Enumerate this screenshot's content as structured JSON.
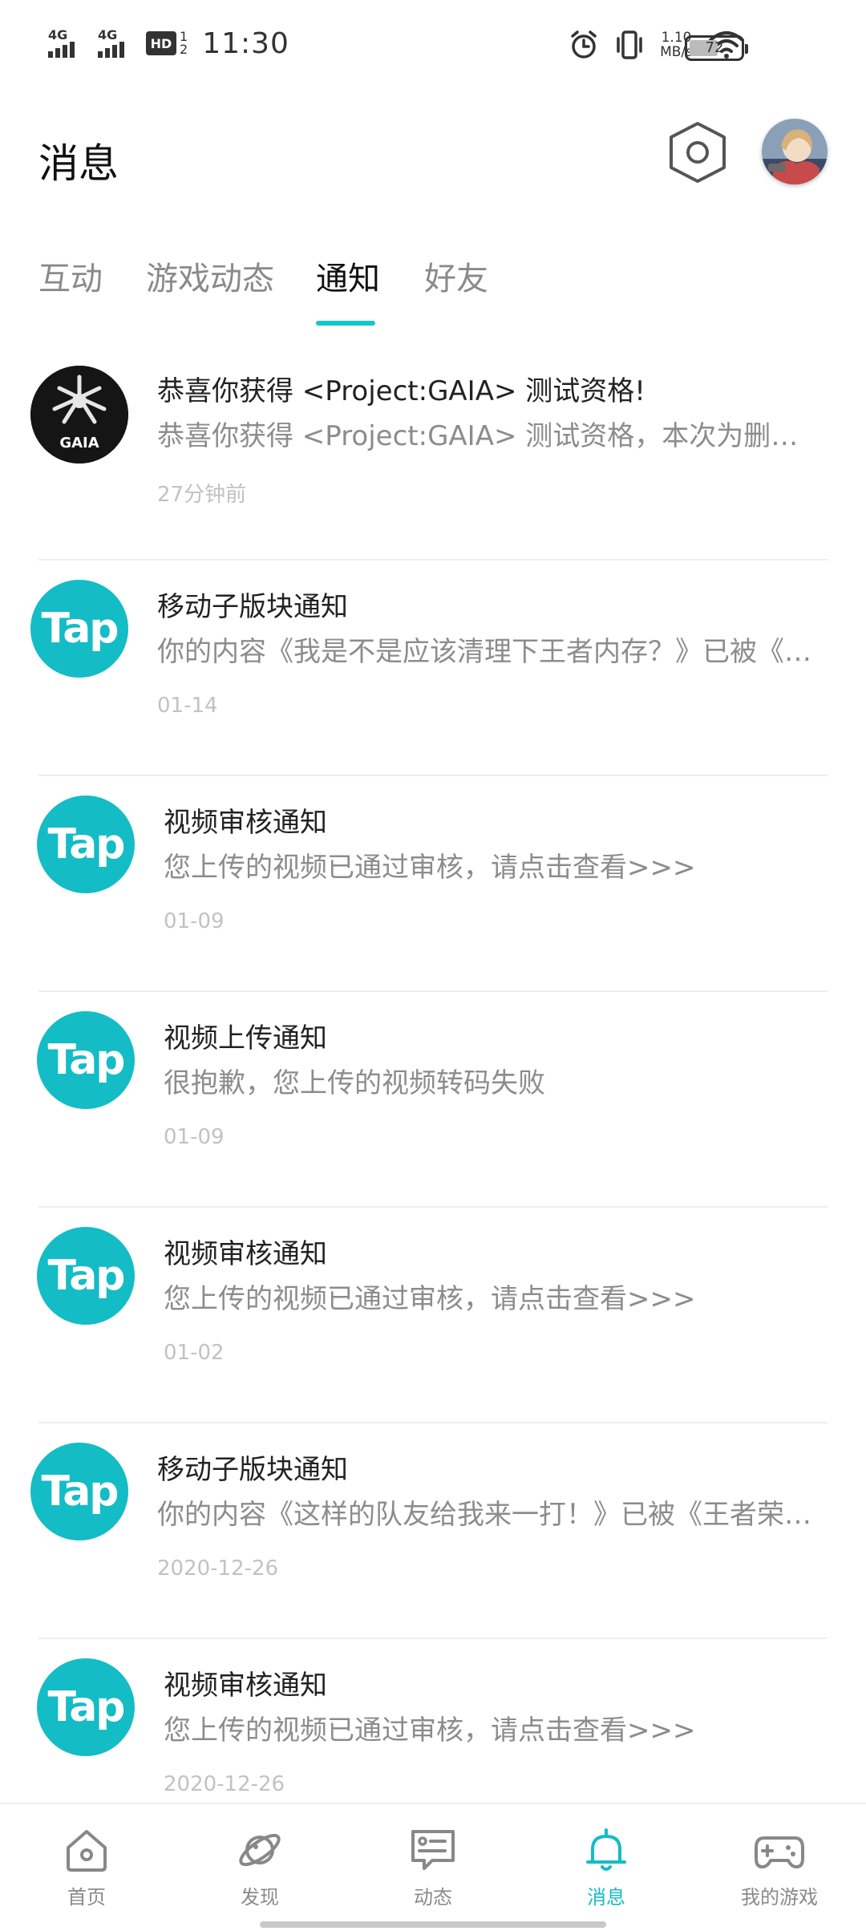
{
  "status_bar": {
    "network1": "4G",
    "network2": "4G",
    "hd": "HD",
    "hd_sub": "2",
    "sub1": "1",
    "time": "11:30",
    "speed_value": "1.10",
    "speed_unit": "MB/s",
    "battery": "72"
  },
  "header": {
    "title": "消息"
  },
  "tabs": [
    {
      "label": "互动"
    },
    {
      "label": "游戏动态"
    },
    {
      "label": "通知",
      "active": true
    },
    {
      "label": "好友"
    }
  ],
  "tap_logo_text": "Tap",
  "gaia_logo_text": "GAIA",
  "notifications": [
    {
      "title": "恭喜你获得 <Project:GAIA> 测试资格!",
      "desc": "恭喜你获得 <Project:GAIA> 测试资格，本次为删…",
      "time": "27分钟前",
      "icon": "gaia-logo"
    },
    {
      "title": "移动子版块通知",
      "desc": "你的内容《我是不是应该清理下王者内存？》已被《…",
      "time": "01-14",
      "icon": "tap-logo"
    },
    {
      "title": "视频审核通知",
      "desc": "您上传的视频已通过审核，请点击查看>>>",
      "time": "01-09",
      "icon": "tap-logo"
    },
    {
      "title": "视频上传通知",
      "desc": "很抱歉，您上传的视频转码失败",
      "time": "01-09",
      "icon": "tap-logo"
    },
    {
      "title": "视频审核通知",
      "desc": "您上传的视频已通过审核，请点击查看>>>",
      "time": "01-02",
      "icon": "tap-logo"
    },
    {
      "title": "移动子版块通知",
      "desc": "你的内容《这样的队友给我来一打！》已被《王者荣…",
      "time": "2020-12-26",
      "icon": "tap-logo"
    },
    {
      "title": "视频审核通知",
      "desc": "您上传的视频已通过审核，请点击查看>>>",
      "time": "2020-12-26",
      "icon": "tap-logo"
    }
  ],
  "bottom_nav": [
    {
      "label": "首页",
      "icon": "home-icon"
    },
    {
      "label": "发现",
      "icon": "planet-icon"
    },
    {
      "label": "动态",
      "icon": "chat-card-icon"
    },
    {
      "label": "消息",
      "icon": "bell-icon",
      "active": true
    },
    {
      "label": "我的游戏",
      "icon": "gamepad-icon"
    }
  ],
  "colors": {
    "accent": "#14bcc6",
    "tab_indicator": "#15c5ce"
  }
}
